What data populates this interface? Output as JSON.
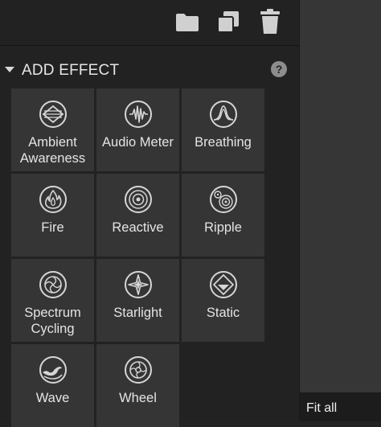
{
  "toolbar": {
    "icons": [
      "folder-icon",
      "duplicate-icon",
      "trash-icon"
    ]
  },
  "section": {
    "title": "ADD EFFECT",
    "help": "?"
  },
  "effects": [
    {
      "label": "Ambient Awareness",
      "line1": "Ambient",
      "line2": "Awareness",
      "icon": "ambient-awareness-icon"
    },
    {
      "label": "Audio Meter",
      "line1": "Audio Meter",
      "line2": "",
      "icon": "audio-meter-icon"
    },
    {
      "label": "Breathing",
      "line1": "Breathing",
      "line2": "",
      "icon": "breathing-icon"
    },
    {
      "label": "Fire",
      "line1": "Fire",
      "line2": "",
      "icon": "fire-icon"
    },
    {
      "label": "Reactive",
      "line1": "Reactive",
      "line2": "",
      "icon": "reactive-icon"
    },
    {
      "label": "Ripple",
      "line1": "Ripple",
      "line2": "",
      "icon": "ripple-icon"
    },
    {
      "label": "Spectrum Cycling",
      "line1": "Spectrum",
      "line2": "Cycling",
      "icon": "spectrum-cycling-icon"
    },
    {
      "label": "Starlight",
      "line1": "Starlight",
      "line2": "",
      "icon": "starlight-icon"
    },
    {
      "label": "Static",
      "line1": "Static",
      "line2": "",
      "icon": "static-icon"
    },
    {
      "label": "Wave",
      "line1": "Wave",
      "line2": "",
      "icon": "wave-icon"
    },
    {
      "label": "Wheel",
      "line1": "Wheel",
      "line2": "",
      "icon": "wheel-icon"
    }
  ],
  "right_panel": {
    "fit_all_label": "Fit all"
  },
  "colors": {
    "panel_bg": "#222222",
    "tile_bg": "#353535",
    "icon_color": "#d6d6d6",
    "text_color": "#e4e4e4"
  }
}
